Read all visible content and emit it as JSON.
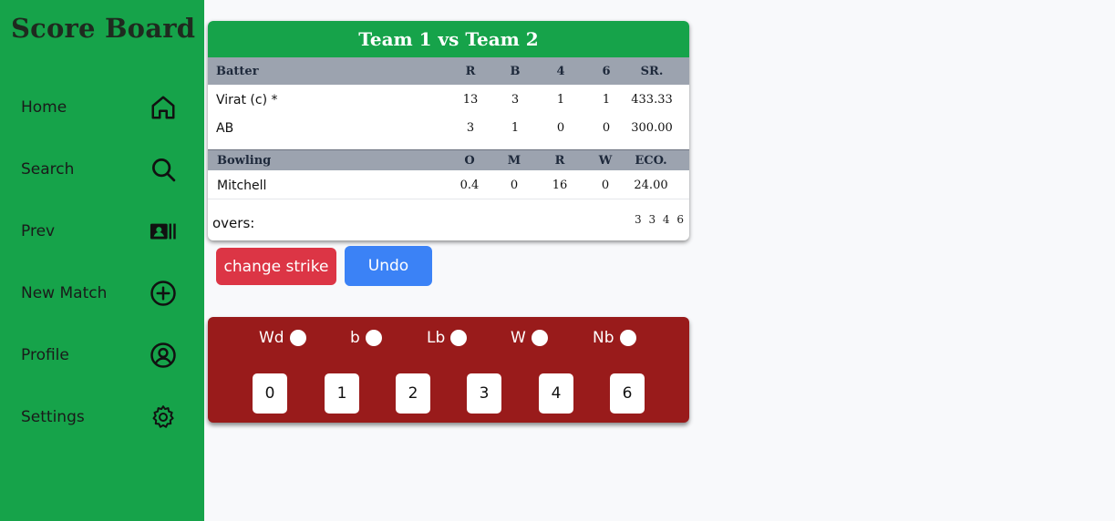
{
  "app": {
    "title": "Score Board"
  },
  "sidebar": {
    "items": [
      {
        "label": "Home",
        "icon": "home-icon"
      },
      {
        "label": "Search",
        "icon": "search-icon"
      },
      {
        "label": "Prev",
        "icon": "contact-card-icon"
      },
      {
        "label": "New Match",
        "icon": "plus-circle-icon"
      },
      {
        "label": "Profile",
        "icon": "user-circle-icon"
      },
      {
        "label": "Settings",
        "icon": "gear-icon"
      }
    ]
  },
  "match": {
    "title": "Team 1 vs Team 2",
    "batting": {
      "headers": [
        "Batter",
        "R",
        "B",
        "4",
        "6",
        "SR."
      ],
      "rows": [
        {
          "name": "Virat (c) *",
          "r": "13",
          "b": "3",
          "fours": "1",
          "sixes": "1",
          "sr": "433.33"
        },
        {
          "name": "AB",
          "r": "3",
          "b": "1",
          "fours": "0",
          "sixes": "0",
          "sr": "300.00"
        }
      ]
    },
    "bowling": {
      "headers": [
        "Bowling",
        "O",
        "M",
        "R",
        "W",
        "ECO."
      ],
      "rows": [
        {
          "name": "Mitchell",
          "o": "0.4",
          "m": "0",
          "r": "16",
          "w": "0",
          "eco": "24.00"
        }
      ]
    },
    "overs": {
      "label": "overs:",
      "balls": "3 3 4 6"
    }
  },
  "actions": {
    "change_strike": "change strike",
    "undo": "Undo"
  },
  "extras": [
    "Wd",
    "b",
    "Lb",
    "W",
    "Nb"
  ],
  "runs": [
    "0",
    "1",
    "2",
    "3",
    "4",
    "6"
  ],
  "colors": {
    "sidebar": "#16a34a",
    "panel": "#991b1b",
    "strike": "#dc3545",
    "undo": "#3b82f6"
  }
}
